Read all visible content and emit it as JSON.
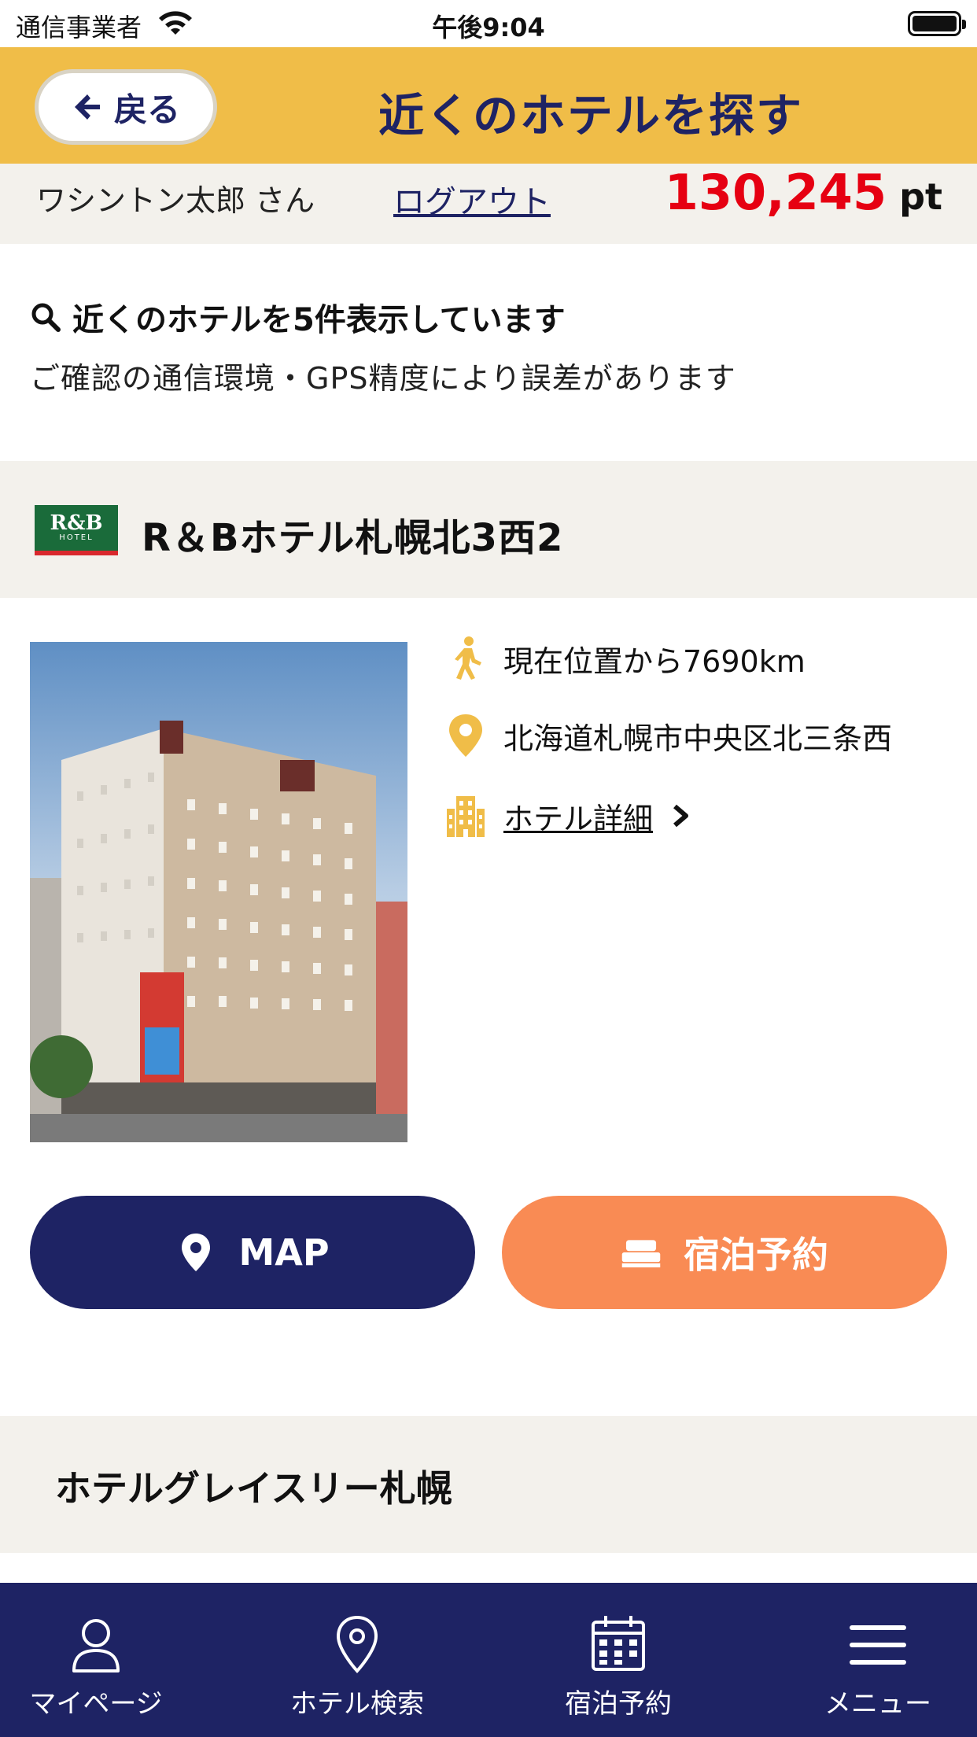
{
  "status_bar": {
    "carrier": "通信事業者",
    "time": "午後9:04",
    "wifi_icon": "wifi-icon",
    "battery_icon": "battery-icon"
  },
  "header": {
    "back_label": "戻る",
    "title": "近くのホテルを探す",
    "background_color": "#f0bd48",
    "title_color": "#1e2364"
  },
  "user": {
    "name": "ワシントン太郎 さん",
    "logout_label": "ログアウト",
    "points": "130,245",
    "points_unit": "pt",
    "points_color": "#e60012"
  },
  "info": {
    "count_text": "近くのホテルを5件表示しています",
    "note": "ご確認の通信環境・GPS精度により誤差があります"
  },
  "hotels": [
    {
      "name": "R＆Bホテル札幌北3西2",
      "distance": "現在位置から7690km",
      "address": "北海道札幌市中央区北三条西",
      "detail_label": "ホテル詳細",
      "map_label": "MAP",
      "reserve_label": "宿泊予約"
    },
    {
      "name": "ホテルグレイスリー札幌"
    }
  ],
  "tabbar": {
    "background_color": "#1e2364",
    "items": [
      {
        "label": "マイページ",
        "icon": "person-icon"
      },
      {
        "label": "ホテル検索",
        "icon": "map-pin-icon"
      },
      {
        "label": "宿泊予約",
        "icon": "calendar-icon"
      },
      {
        "label": "メニュー",
        "icon": "hamburger-menu-icon"
      }
    ]
  }
}
